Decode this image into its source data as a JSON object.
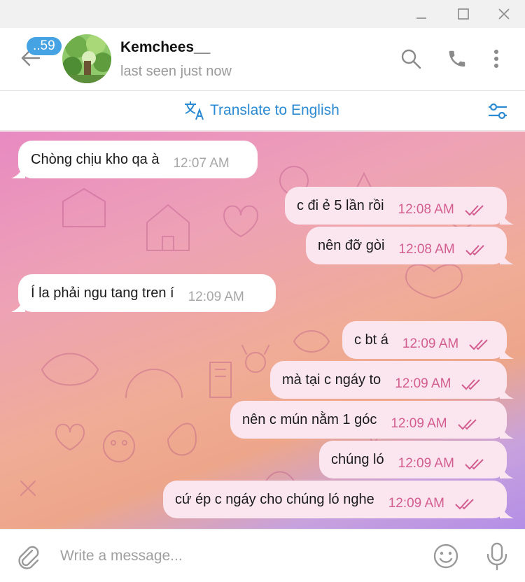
{
  "header": {
    "unread_count": "..59",
    "contact_name": "Kemchees__",
    "status": "last seen just now"
  },
  "translate_bar": {
    "label": "Translate to English"
  },
  "messages": [
    {
      "text": "Chòng chịu kho qa à",
      "time": "12:07 AM",
      "direction": "in"
    },
    {
      "text": "c đi ẻ 5 lần rồi",
      "time": "12:08 AM",
      "direction": "out",
      "status": "read"
    },
    {
      "text": "nên đỡ gòi",
      "time": "12:08 AM",
      "direction": "out",
      "status": "read"
    },
    {
      "text": "Í la phải ngu tang tren í",
      "time": "12:09 AM",
      "direction": "in"
    },
    {
      "text": "c bt á",
      "time": "12:09 AM",
      "direction": "out",
      "status": "read"
    },
    {
      "text": "mà tại c ngáy to",
      "time": "12:09 AM",
      "direction": "out",
      "status": "read"
    },
    {
      "text": "nên c mún nằm 1 góc",
      "time": "12:09 AM",
      "direction": "out",
      "status": "read"
    },
    {
      "text": "chúng ló",
      "time": "12:09 AM",
      "direction": "out",
      "status": "read"
    },
    {
      "text": "cứ ép c ngáy cho chúng ló nghe",
      "time": "12:09 AM",
      "direction": "out",
      "status": "read"
    }
  ],
  "composer": {
    "placeholder": "Write a message..."
  },
  "colors": {
    "accent": "#2b8ad2",
    "badge": "#45a3e3",
    "outgoing_bubble": "#fbe6f0",
    "outgoing_time": "#d35d8f",
    "wallpaper_start": "#e88ac2",
    "wallpaper_end": "#b48ee6"
  }
}
